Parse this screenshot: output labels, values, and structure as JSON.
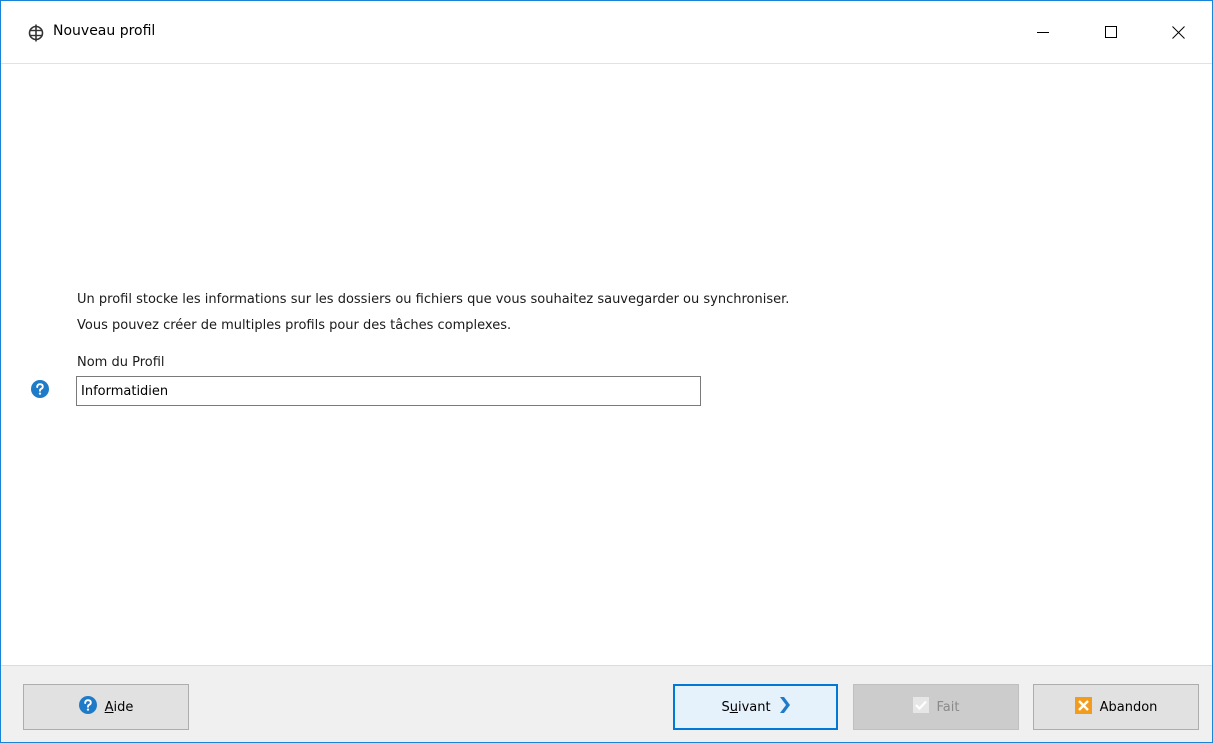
{
  "window": {
    "title": "Nouveau profil",
    "accent_color": "#1883d7",
    "controls": {
      "minimize": "minimize-icon",
      "maximize": "maximize-icon",
      "close": "close-icon"
    }
  },
  "content": {
    "description_line_1": "Un profil stocke les informations sur les dossiers ou fichiers que vous souhaitez sauvegarder ou synchroniser.",
    "description_line_2": "Vous pouvez créer de multiples profils pour des tâches complexes.",
    "field_label": "Nom du Profil",
    "profile_name_value": "Informatidien",
    "help_icon": "question-circle-icon"
  },
  "footer": {
    "aide": {
      "underlined": "A",
      "rest": "ide",
      "icon": "question-circle-icon"
    },
    "suivant": {
      "before": "S",
      "underlined": "u",
      "rest": "ivant",
      "icon": "chevron-right-icon"
    },
    "fait": {
      "label": "Fait",
      "icon": "checkmark-icon",
      "enabled": false
    },
    "abandon": {
      "label": "Abandon",
      "icon": "cancel-x-icon"
    }
  }
}
